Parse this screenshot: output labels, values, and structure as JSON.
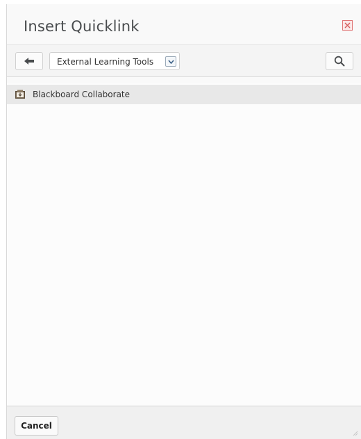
{
  "dialog": {
    "title": "Insert Quicklink",
    "close_icon": "close-icon"
  },
  "toolbar": {
    "back_icon": "arrow-left-icon",
    "category_selected": "External Learning Tools",
    "dropdown_icon": "chevron-down-icon",
    "search_icon": "search-icon"
  },
  "list": {
    "items": [
      {
        "label": "Blackboard Collaborate",
        "icon": "launch-tool-icon"
      }
    ]
  },
  "footer": {
    "cancel_label": "Cancel"
  },
  "colors": {
    "close_border": "#e07474",
    "selected_row": "#e8e8e8",
    "dialog_bg": "#f9f9f9"
  }
}
